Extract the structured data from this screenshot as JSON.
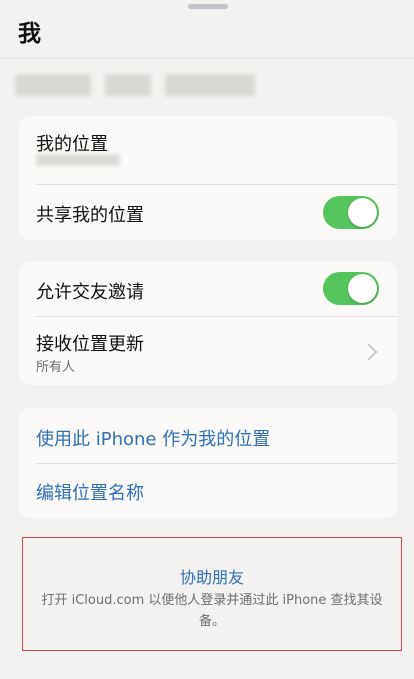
{
  "header": {
    "title": "我"
  },
  "location_card": {
    "my_location_label": "我的位置",
    "share_location_label": "共享我的位置",
    "share_location_on": true
  },
  "friends_card": {
    "allow_requests_label": "允许交友邀请",
    "allow_requests_on": true,
    "receive_updates_label": "接收位置更新",
    "receive_updates_value": "所有人"
  },
  "actions_card": {
    "use_iphone_label": "使用此 iPhone 作为我的位置",
    "edit_name_label": "编辑位置名称"
  },
  "help": {
    "title": "协助朋友",
    "description": "打开 iCloud.com 以便他人登录并通过此 iPhone 查找其设备。"
  },
  "colors": {
    "toggle_on": "#53c55a",
    "link_blue": "#2f6fba",
    "highlight_border": "#d9454a"
  }
}
